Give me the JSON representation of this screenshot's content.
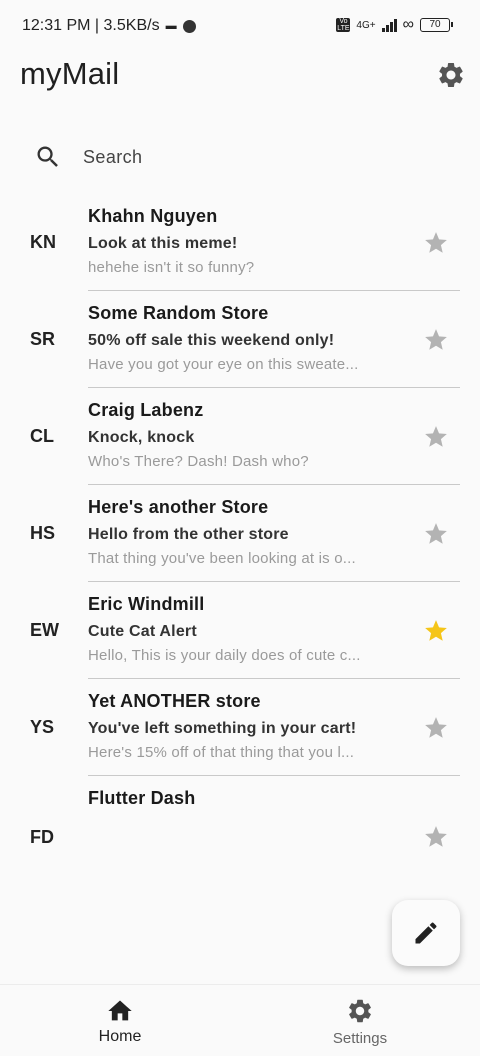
{
  "status_bar": {
    "time_speed": "12:31 PM | 3.5KB/s",
    "network_label": "4G+",
    "volte_label": "Vo LTE",
    "battery": "70"
  },
  "app": {
    "title": "myMail"
  },
  "search": {
    "label": "Search"
  },
  "emails": [
    {
      "initials": "KN",
      "sender": "Khahn Nguyen",
      "subject": "Look at this meme!",
      "preview": "hehehe isn't it so funny?",
      "starred": false
    },
    {
      "initials": "SR",
      "sender": "Some Random Store",
      "subject": "50% off sale this weekend only!",
      "preview": "Have you got your eye on this sweate...",
      "starred": false
    },
    {
      "initials": "CL",
      "sender": "Craig Labenz",
      "subject": "Knock, knock",
      "preview": "Who's There? Dash! Dash who?",
      "starred": false
    },
    {
      "initials": "HS",
      "sender": "Here's another Store",
      "subject": "Hello from the other store",
      "preview": "That thing you've been looking at is o...",
      "starred": false
    },
    {
      "initials": "EW",
      "sender": "Eric Windmill",
      "subject": "Cute Cat Alert",
      "preview": "Hello, This is your daily does of cute c...",
      "starred": true
    },
    {
      "initials": "YS",
      "sender": "Yet ANOTHER store",
      "subject": "You've left something in your cart!",
      "preview": "Here's 15% off of that thing that you l...",
      "starred": false
    },
    {
      "initials": "FD",
      "sender": "Flutter Dash",
      "subject": "",
      "preview": "",
      "starred": false
    }
  ],
  "colors": {
    "star_active": "#f5c518",
    "star_inactive": "#b3b3b3"
  },
  "bottom_nav": {
    "home_label": "Home",
    "settings_label": "Settings",
    "selected": "Home"
  },
  "icons": {
    "settings": "gear-icon",
    "search": "search-icon",
    "star": "star-icon",
    "compose": "pencil-icon",
    "home": "home-icon"
  }
}
